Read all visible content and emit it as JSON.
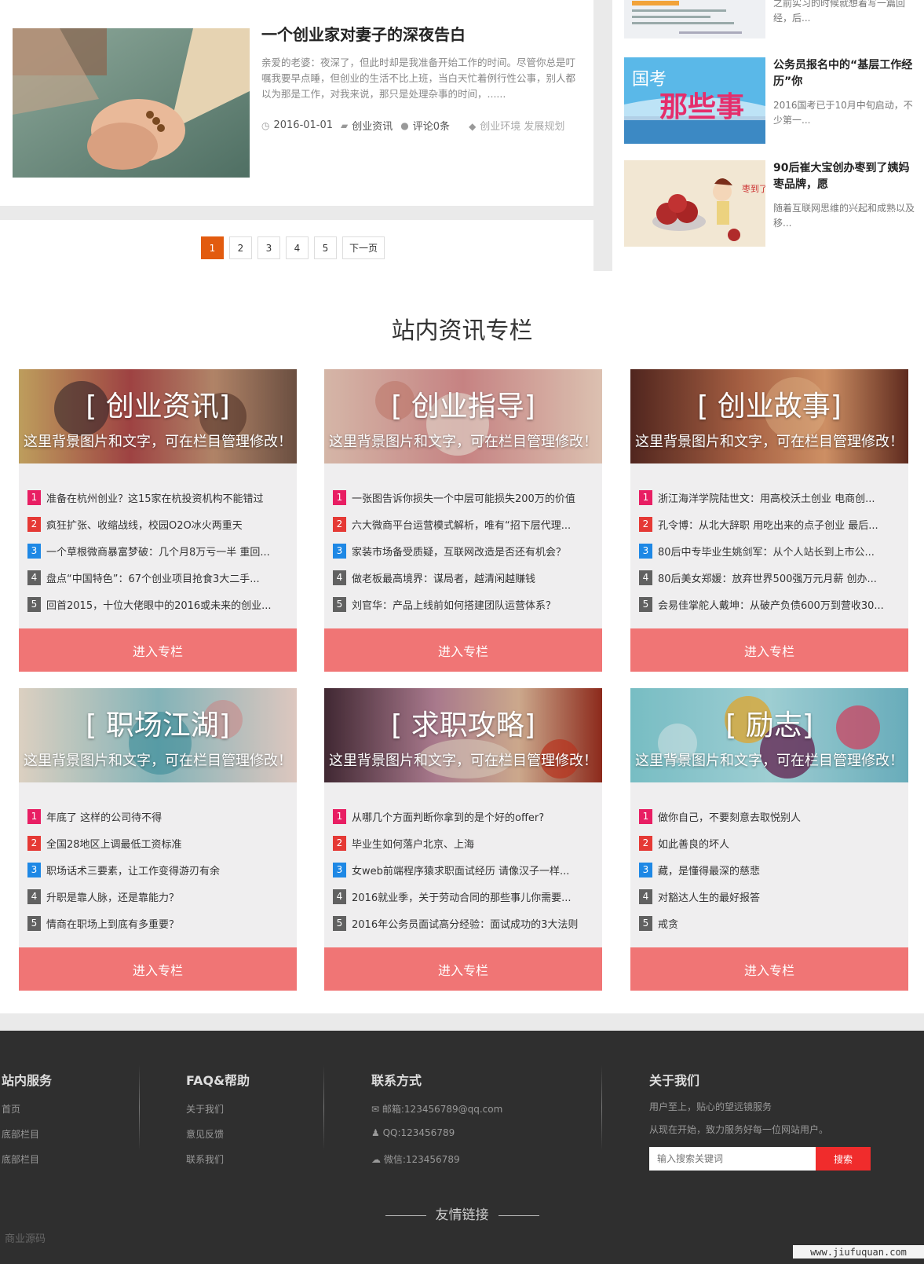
{
  "article": {
    "title": "一个创业家对妻子的深夜告白",
    "desc": "亲爱的老婆：夜深了，但此时却是我准备开始工作的时间。尽管你总是叮嘱我要早点睡，但创业的生活不比上班，当白天忙着例行性公事，别人都以为那是工作，对我来说，那只是处理杂事的时间，......",
    "date": "2016-01-01",
    "category": "创业资讯",
    "comments": "评论0条",
    "tags": "创业环境 发展规划"
  },
  "pagination": {
    "pages": [
      "1",
      "2",
      "3",
      "4",
      "5"
    ],
    "active": "1",
    "next": "下一页"
  },
  "sidebar": {
    "top_desc": "之前实习的时候就想着写一篇回经，后...",
    "items": [
      {
        "title": "公务员报名中的“基层工作经历”你",
        "desc": "2016国考已于10月中旬启动，不少第一..."
      },
      {
        "title": "90后崔大宝创办枣到了姨妈枣品牌，愿",
        "desc": "随着互联网思维的兴起和成熟以及移..."
      }
    ]
  },
  "section": {
    "title": "站内资讯专栏",
    "banner_sub": "这里背景图片和文字，可在栏目管理修改！",
    "button_label": "进入专栏",
    "cards": [
      {
        "title": "[ 创业资讯]",
        "items": [
          "准备在杭州创业？这15家在杭投资机构不能错过",
          "疯狂扩张、收缩战线，校园O2O冰火两重天",
          "一个草根微商暴富梦破：几个月8万亏一半 重回...",
          "盘点“中国特色”：67个创业项目抢食3大二手...",
          "回首2015，十位大佬眼中的2016或未来的创业..."
        ]
      },
      {
        "title": "[ 创业指导]",
        "items": [
          "一张图告诉你损失一个中层可能损失200万的价值",
          "六大微商平台运营模式解析，唯有“招下层代理...",
          "家装市场备受质疑，互联网改造是否还有机会？",
          "做老板最高境界：谋局者，越清闲越赚钱",
          "刘官华：产品上线前如何搭建团队运营体系？"
        ]
      },
      {
        "title": "[ 创业故事]",
        "items": [
          "浙江海洋学院陆世文：用高校沃土创业 电商创...",
          "孔令博：从北大辞职 用吃出来的点子创业 最后...",
          "80后中专毕业生姚剑军：从个人站长到上市公...",
          "80后美女郑媛：放弃世界500强万元月薪 创办...",
          "会易佳掌舵人戴坤：从破产负债600万到营收30..."
        ]
      },
      {
        "title": "[ 职场江湖]",
        "items": [
          "年底了 这样的公司待不得",
          "全国28地区上调最低工资标准",
          "职场话术三要素，让工作变得游刃有余",
          "升职是靠人脉，还是靠能力？",
          "情商在职场上到底有多重要？"
        ]
      },
      {
        "title": "[ 求职攻略]",
        "items": [
          "从哪几个方面判断你拿到的是个好的offer?",
          "毕业生如何落户北京、上海",
          "女web前端程序猿求职面试经历 请像汉子一样...",
          "2016就业季，关于劳动合同的那些事儿你需要...",
          "2016年公务员面试高分经验：面试成功的3大法则"
        ]
      },
      {
        "title": "[ 励志]",
        "items": [
          "做你自己，不要刻意去取悦别人",
          "如此善良的坏人",
          "藏，是懂得最深的慈悲",
          "对豁达人生的最好报答",
          "戒贪"
        ]
      }
    ]
  },
  "footer": {
    "col1": {
      "title": "站内服务",
      "links": [
        "首页",
        "底部栏目",
        "底部栏目"
      ]
    },
    "col2": {
      "title": "FAQ&帮助",
      "links": [
        "关于我们",
        "意见反馈",
        "联系我们"
      ]
    },
    "col3": {
      "title": "联系方式",
      "email": "邮箱:123456789@qq.com",
      "qq": "QQ:123456789",
      "wechat": "微信:123456789"
    },
    "col4": {
      "title": "关于我们",
      "line1": "用户至上，贴心的望远镜服务",
      "line2": "从现在开始，致力服务好每一位网站用户。",
      "search_placeholder": "输入搜索关键词",
      "search_button": "搜索"
    },
    "friend_links": "友情链接",
    "bottom_link": "商业源码",
    "watermark": "www.jiufuquan.com"
  }
}
